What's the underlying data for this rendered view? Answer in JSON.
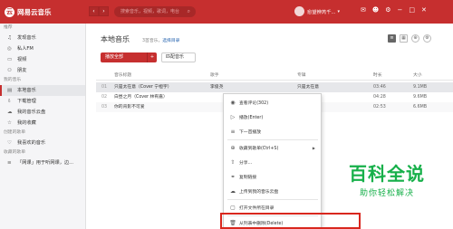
{
  "topbar": {
    "logo_glyph": "云",
    "logo_text": "网易云音乐",
    "back_glyph": "‹",
    "forward_glyph": "›",
    "search_placeholder": "搜索音乐，视频，歌词，电台",
    "username": "愈望辨芮千...",
    "icons": [
      "mail-icon",
      "shirt-icon",
      "gear-icon",
      "minimize-icon",
      "maximize-icon",
      "close-icon"
    ]
  },
  "sidebar": {
    "sections": [
      {
        "head": "推荐",
        "items": [
          {
            "icon": "♫",
            "label": "发现音乐"
          },
          {
            "icon": "◎",
            "label": "私人FM"
          },
          {
            "icon": "▭",
            "label": "视频"
          },
          {
            "icon": "⚇",
            "label": "朋友"
          }
        ]
      },
      {
        "head": "我的音乐",
        "items": [
          {
            "icon": "▤",
            "label": "本地音乐",
            "active": true
          },
          {
            "icon": "⇩",
            "label": "下载管理"
          },
          {
            "icon": "☁",
            "label": "我的音乐云盘"
          },
          {
            "icon": "☆",
            "label": "我的收藏"
          }
        ]
      },
      {
        "head": "创建的歌单",
        "items": [
          {
            "icon": "♡",
            "label": "我喜欢的音乐"
          }
        ]
      },
      {
        "head": "收藏的歌单",
        "items": [
          {
            "icon": "≡",
            "label": "「网课」用于听网课，边..."
          }
        ]
      }
    ]
  },
  "main": {
    "title": "本地音乐",
    "count_text": "3首音乐，",
    "choose_dir": "选择目录",
    "play_all": "播放全部",
    "play_all_plus": "+",
    "match": "匹配音乐",
    "columns": [
      "音乐标题",
      "歌手",
      "专辑",
      "时长",
      "大小"
    ],
    "rows": [
      {
        "no": "01",
        "title": "只是太在意（Cover 宁桓宇）",
        "artist": "李俊尧",
        "album": "只是太在意",
        "time": "03:46",
        "size": "9.1MB"
      },
      {
        "no": "02",
        "title": "白昼之月（Cover 林宥嘉）",
        "artist": "",
        "album": "",
        "time": "04:28",
        "size": "9.6MB"
      },
      {
        "no": "03",
        "title": "你的背影不可爱",
        "artist": "",
        "album": "",
        "time": "02:53",
        "size": "6.6MB"
      }
    ]
  },
  "context_menu": {
    "items": [
      {
        "icon": "◉",
        "label": "查看评论(302)"
      },
      {
        "icon": "▷",
        "label": "播放(Enter)"
      },
      {
        "icon": "≡",
        "label": "下一首播放"
      },
      {
        "icon": "⊕",
        "label": "收藏到歌单(Ctrl+S)",
        "arrow": "▶"
      },
      {
        "icon": "⇧",
        "label": "分享..."
      },
      {
        "icon": "⚭",
        "label": "复制链接"
      },
      {
        "icon": "☁",
        "label": "上传到我的音乐云盘"
      },
      {
        "icon": "▢",
        "label": "打开文件所在目录"
      },
      {
        "icon": "🗑",
        "label": "从列表中删除(Delete)"
      }
    ]
  },
  "watermark": {
    "big": "百科全说",
    "small": "助你轻松解决"
  },
  "colors": {
    "brand": "#c62f2f",
    "highlight": "#d9271e",
    "watermark": "#17b04a"
  }
}
